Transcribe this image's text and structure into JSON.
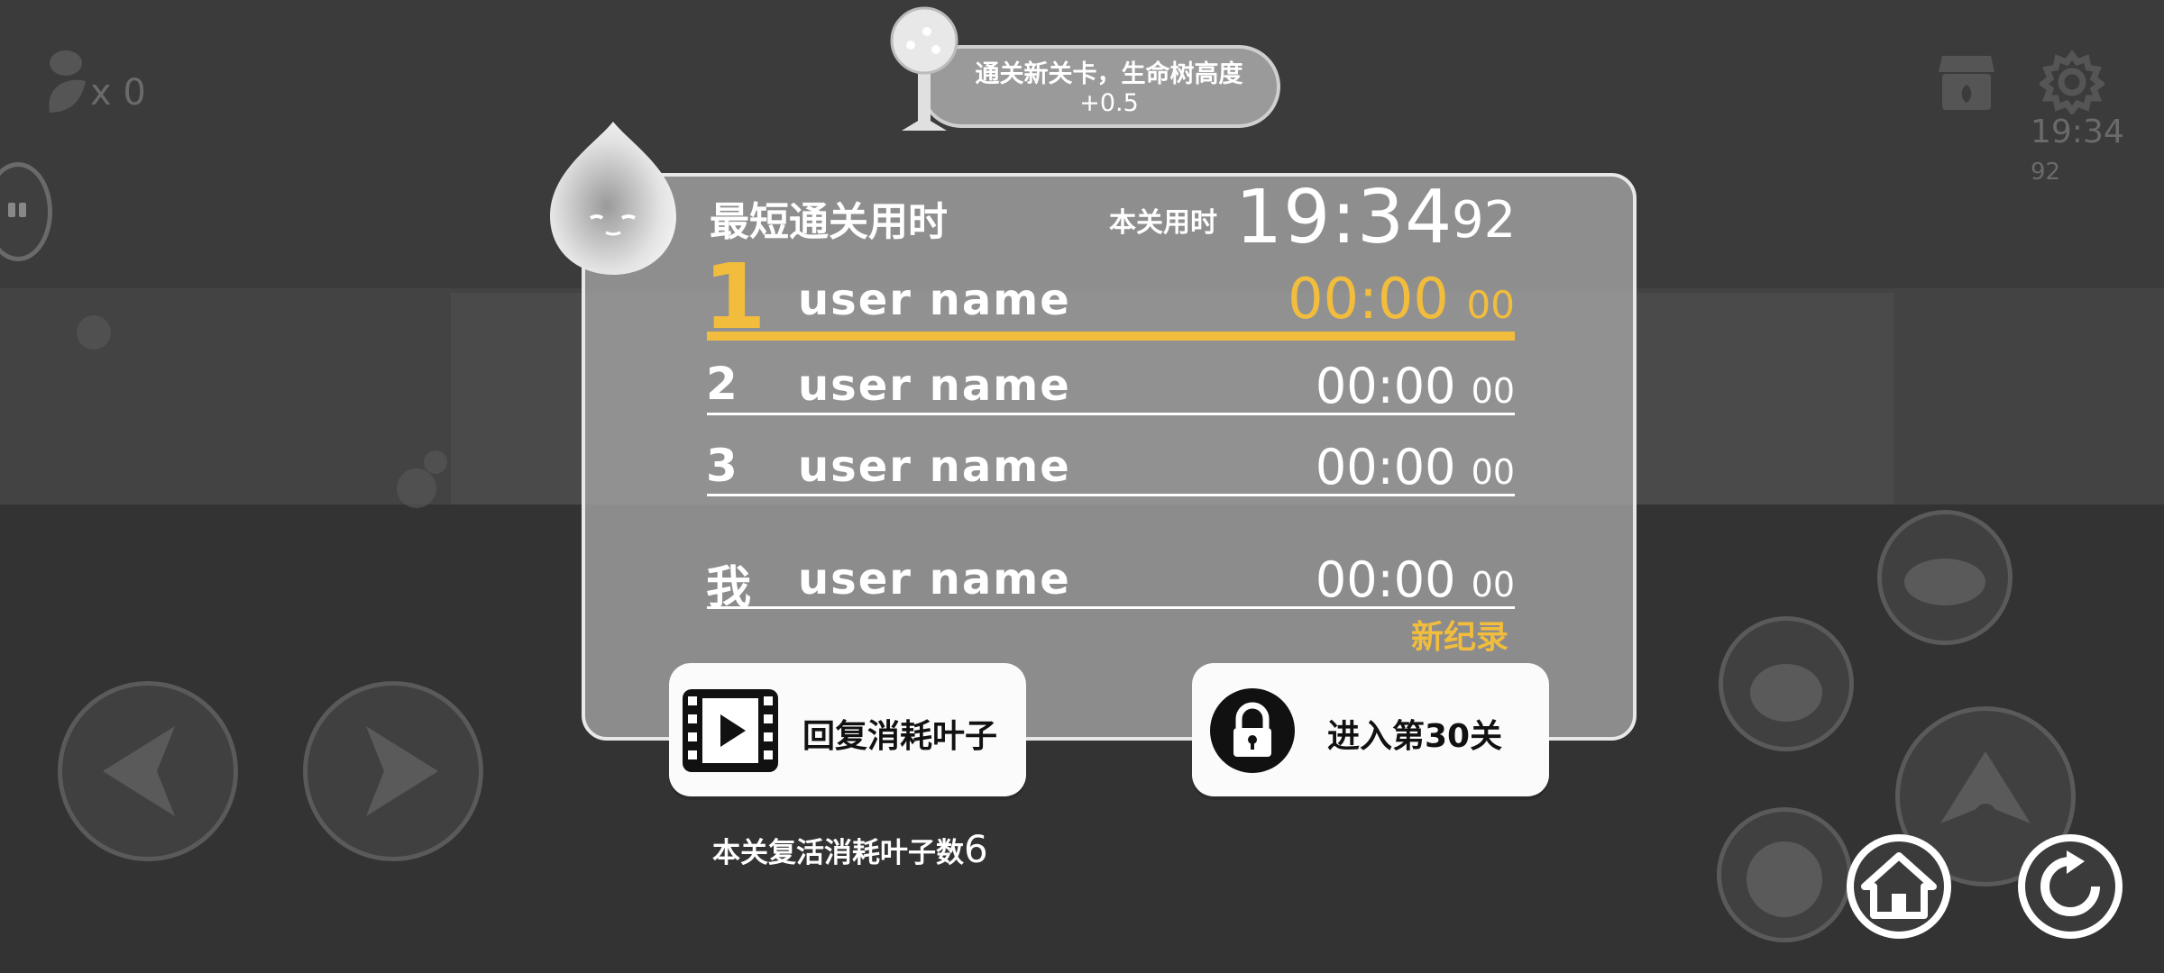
{
  "hud": {
    "leaf_count": "x 0",
    "top_timer_main": "19:34",
    "top_timer_sub": "92"
  },
  "notification": {
    "line1": "通关新关卡，生命树高度",
    "line2": "+0.5"
  },
  "results": {
    "title": "最短通关用时",
    "current_label": "本关用时",
    "current_time_main": "19:34",
    "current_time_sub": "92",
    "rows": [
      {
        "rank": "1",
        "name": "user name",
        "time_main": "00:00",
        "time_sub": "00"
      },
      {
        "rank": "2",
        "name": "user name",
        "time_main": "00:00",
        "time_sub": "00"
      },
      {
        "rank": "3",
        "name": "user name",
        "time_main": "00:00",
        "time_sub": "00"
      }
    ],
    "me": {
      "rank": "我",
      "name": "user name",
      "time_main": "00:00",
      "time_sub": "00"
    },
    "new_record": "新纪录"
  },
  "buttons": {
    "revive_label": "回复消耗叶子",
    "next_label": "进入第30关"
  },
  "revive_note": {
    "text": "本关复活消耗叶子数",
    "count": "6"
  },
  "colors": {
    "accent_gold": "#f2bd3c",
    "panel_bg": "#a5a5a5",
    "button_bg": "#fbfbfb",
    "scene_bg": "#3b3b3b"
  },
  "icons": [
    "leaf-icon",
    "chat-bubble-icon",
    "shop-icon",
    "gear-icon",
    "tree-icon",
    "blob-avatar",
    "film-icon",
    "lock-icon",
    "left-arrow-icon",
    "right-arrow-icon",
    "jump-icon",
    "home-icon",
    "restart-icon"
  ]
}
